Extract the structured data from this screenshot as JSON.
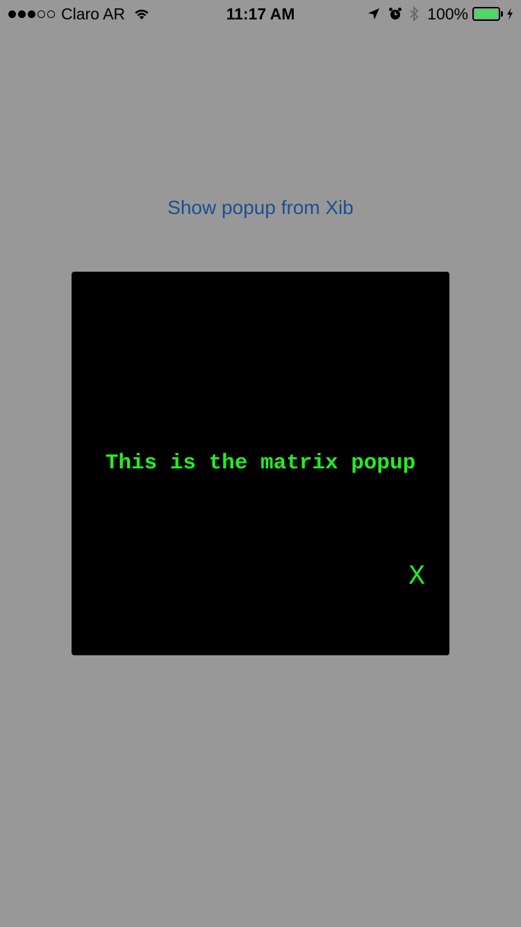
{
  "status_bar": {
    "carrier": "Claro AR",
    "signal_strength": 3,
    "signal_max": 5,
    "time": "11:17 AM",
    "battery_percent_label": "100%",
    "battery_level": 1.0,
    "battery_color": "#4cd964",
    "icons": [
      "signal-dots-icon",
      "wifi-icon",
      "location-arrow-icon",
      "alarm-clock-icon",
      "bluetooth-icon",
      "battery-icon",
      "charging-bolt-icon"
    ]
  },
  "main": {
    "show_popup_label": "Show popup from Xib",
    "link_color": "#1a5091"
  },
  "popup": {
    "close_label": "X",
    "message": "This is the matrix popup",
    "text_color": "#22ee22",
    "background_color": "#000000"
  }
}
